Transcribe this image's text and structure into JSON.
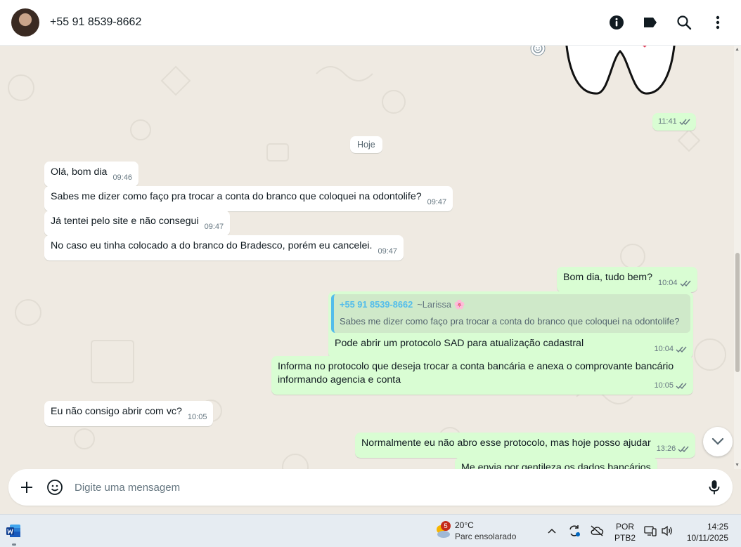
{
  "header": {
    "contact_name": "+55 91 8539-8662",
    "icons": [
      "info-icon",
      "label-icon",
      "search-icon",
      "menu-icon"
    ]
  },
  "chat": {
    "prev_sticker_time": "11:41",
    "day_chip": "Hoje",
    "messages": [
      {
        "dir": "in",
        "text": "Olá, bom dia",
        "time": "09:46"
      },
      {
        "dir": "in",
        "text": "Sabes me dizer como faço pra trocar a conta do branco que coloquei na odontolife?",
        "time": "09:47"
      },
      {
        "dir": "in",
        "text": "Já tentei pelo site e não consegui",
        "time": "09:47"
      },
      {
        "dir": "in",
        "text": "No caso eu tinha colocado a do branco do Bradesco, porém eu cancelei.",
        "time": "09:47"
      },
      {
        "dir": "out",
        "text": "Bom dia, tudo bem?",
        "time": "10:04"
      },
      {
        "dir": "out",
        "quote_author": "+55 91 8539-8662",
        "quote_alias": "~Larissa 🌸",
        "quote_text": "Sabes me dizer como faço pra trocar a conta do branco que coloquei na odontolife?",
        "text": "Pode abrir um protocolo SAD para atualização cadastral",
        "time": "10:04"
      },
      {
        "dir": "out",
        "text": "Informa no protocolo que deseja trocar a conta bancária e anexa o comprovante bancário informando agencia e conta",
        "time": "10:05"
      },
      {
        "dir": "in",
        "text": "Eu não consigo abrir com vc?",
        "time": "10:05"
      },
      {
        "dir": "out",
        "text": "Normalmente eu não abro esse protocolo, mas hoje posso ajudar",
        "time": "13:26"
      },
      {
        "dir": "out",
        "text": "Me envia por gentileza os dados bancários",
        "time": ""
      }
    ]
  },
  "compose": {
    "placeholder": "Digite uma mensagem"
  },
  "taskbar": {
    "weather_badge": "5",
    "weather_temp": "20°C",
    "weather_cond": "Parc ensolarado",
    "lang_line1": "POR",
    "lang_line2": "PTB2",
    "time": "14:25",
    "date": "10/11/2025"
  },
  "colors": {
    "incoming_bubble": "#ffffff",
    "outgoing_bubble": "#d9fdd3",
    "chat_bg": "#efeae2",
    "quote_accent": "#53bdeb",
    "tick_color": "#667781"
  }
}
